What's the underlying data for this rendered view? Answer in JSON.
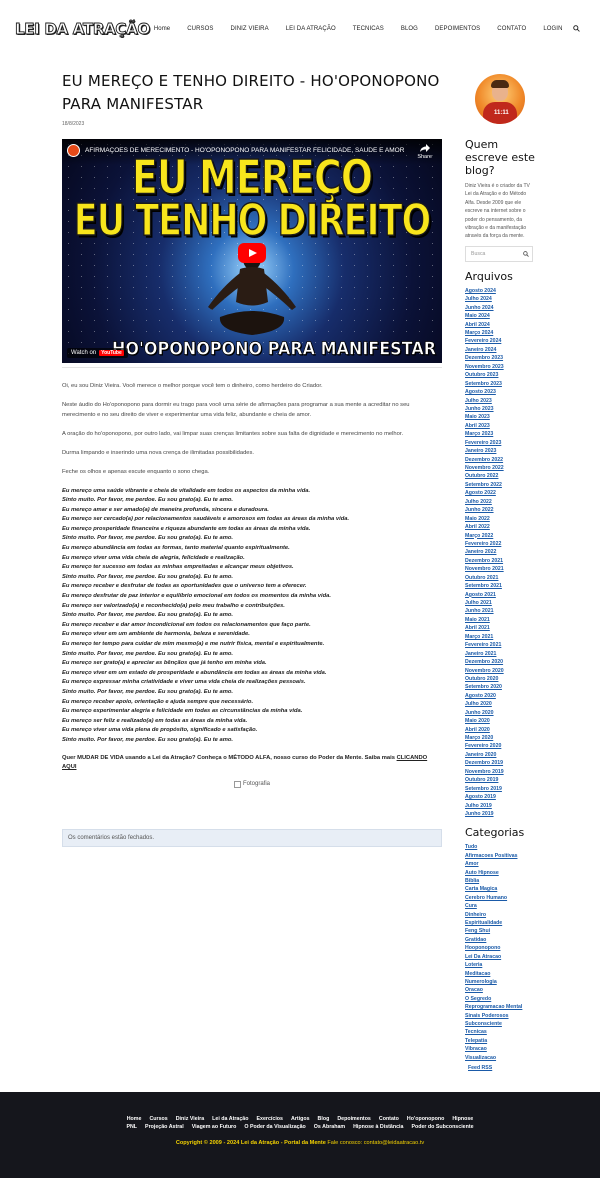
{
  "header": {
    "logo": "LEI DA ATRAÇÃO",
    "nav": [
      "Home",
      "CURSOS",
      "DINIZ VIEIRA",
      "LEI DA ATRAÇÃO",
      "TECNICAS",
      "BLOG",
      "DEPOIMENTOS",
      "CONTATO",
      "LOGIN"
    ]
  },
  "post": {
    "title": "EU MEREÇO E TENHO DIREITO - HO'OPONOPONO PARA MANIFESTAR",
    "date": "18/8/2023",
    "video": {
      "title": "AFIRMAÇÕES DE MERECIMENTO - HO'OPONOPONO PARA MANIFESTAR FELICIDADE, SAÚDE E AMOR | O...",
      "share": "Share",
      "line1": "EU MEREÇO",
      "line2": "EU TENHO DIREITO",
      "line3": "HO'OPONOPONO PARA MANIFESTAR",
      "watch_on": "Watch on",
      "yt": "YouTube"
    },
    "paragraphs": [
      "Oi, eu sou Diniz Vieira. Você merece o melhor porque você tem o dinheiro, como herdeiro do Criador.",
      "Neste áudio do Ho'oponopono para dormir eu trago para você uma série de afirmações para programar a sua mente a acreditar no seu merecimento e no seu direito de viver e experimentar uma vida feliz, abundante e cheia de amor.",
      "A oração do ho'oponopono, por outro lado, vai limpar suas crenças limitantes sobre sua falta de dignidade e merecimento no melhor.",
      "Durma limpando e inserindo uma nova crença de ilimitadas possibilidades.",
      "Feche os olhos e apenas escute enquanto o sono chega."
    ],
    "affirmations": [
      "Eu mereço uma saúde vibrante e cheia de vitalidade em todos os aspectos da minha vida.",
      "Sinto muito. Por favor, me perdoe. Eu sou grato(a). Eu te amo.",
      "Eu mereço amar e ser amado(a) de maneira profunda, sincera e duradoura.",
      "Eu mereço ser cercado(a) por relacionamentos saudáveis e amorosos em todas as áreas da minha vida.",
      "Eu mereço prosperidade financeira e riqueza abundante em todas as áreas da minha vida.",
      "Sinto muito. Por favor, me perdoe. Eu sou grato(a). Eu te amo.",
      "Eu mereço abundância em todas as formas, tanto material quanto espiritualmente.",
      "Eu mereço viver uma vida cheia de alegria, felicidade e realização.",
      "Eu mereço ter sucesso em todas as minhas empreitadas e alcançar meus objetivos.",
      "Sinto muito. Por favor, me perdoe. Eu sou grato(a). Eu te amo.",
      "Eu mereço receber e desfrutar de todas as oportunidades que o universo tem a oferecer.",
      "Eu mereço desfrutar de paz interior e equilíbrio emocional em todos os momentos da minha vida.",
      "Eu mereço ser valorizado(a) e reconhecido(a) pelo meu trabalho e contribuições.",
      "Sinto muito. Por favor, me perdoe. Eu sou grato(a). Eu te amo.",
      "Eu mereço receber e dar amor incondicional em todos os relacionamentos que faço parte.",
      "Eu mereço viver em um ambiente de harmonia, beleza e serenidade.",
      "Eu mereço ter tempo para cuidar de mim mesmo(a) e me nutrir física, mental e espiritualmente.",
      "Sinto muito. Por favor, me perdoe. Eu sou grato(a). Eu te amo.",
      "Eu mereço ser grato(a) e apreciar as bênçãos que já tenho em minha vida.",
      "Eu mereço viver em um estado de prosperidade e abundância em todas as áreas da minha vida.",
      "Eu mereço expressar minha criatividade e viver uma vida cheia de realizações pessoais.",
      "Sinto muito. Por favor, me perdoe. Eu sou grato(a). Eu te amo.",
      "Eu mereço receber apoio, orientação e ajuda sempre que necessário.",
      "Eu mereço experimentar alegria e felicidade em todas as circunstâncias da minha vida.",
      "Eu mereço ser feliz e realizado(a) em todas as áreas da minha vida.",
      "Eu mereço viver uma vida plena de propósito, significado e satisfação.",
      "Sinto muito. Por favor, me perdoe. Eu sou grato(a). Eu te amo."
    ],
    "cta_text": "Quer MUDAR DE VIDA usando a Lei da Atração? Conheça o MÉTODO ALFA, nosso curso do Poder da Mente. Saiba mais ",
    "cta_link": "CLICANDO AQUI",
    "image_alt": "Fotografia",
    "comments_closed": "Os comentários estão fechados."
  },
  "sidebar": {
    "who_title": "Quem escreve este blog?",
    "who_text": "Diniz Vieira é o criador da TV Lei da Atração e do Método Alfa. Desde 2009 que ele escreve na internet sobre o poder do pensamento, da vibração e da manifestação através da força da mente.",
    "search_placeholder": "Busca",
    "archives_title": "Arquivos",
    "archives": [
      "Agosto 2024",
      "Julho 2024",
      "Junho 2024",
      "Maio 2024",
      "Abril 2024",
      "Março 2024",
      "Fevereiro 2024",
      "Janeiro 2024",
      "Dezembro 2023",
      "Novembro 2023",
      "Outubro 2023",
      "Setembro 2023",
      "Agosto 2023",
      "Julho 2023",
      "Junho 2023",
      "Maio 2023",
      "Abril 2023",
      "Março 2023",
      "Fevereiro 2023",
      "Janeiro 2023",
      "Dezembro 2022",
      "Novembro 2022",
      "Outubro 2022",
      "Setembro 2022",
      "Agosto 2022",
      "Julho 2022",
      "Junho 2022",
      "Maio 2022",
      "Abril 2022",
      "Março 2022",
      "Fevereiro 2022",
      "Janeiro 2022",
      "Dezembro 2021",
      "Novembro 2021",
      "Outubro 2021",
      "Setembro 2021",
      "Agosto 2021",
      "Julho 2021",
      "Junho 2021",
      "Maio 2021",
      "Abril 2021",
      "Março 2021",
      "Fevereiro 2021",
      "Janeiro 2021",
      "Dezembro 2020",
      "Novembro 2020",
      "Outubro 2020",
      "Setembro 2020",
      "Agosto 2020",
      "Julho 2020",
      "Junho 2020",
      "Maio 2020",
      "Abril 2020",
      "Março 2020",
      "Fevereiro 2020",
      "Janeiro 2020",
      "Dezembro 2019",
      "Novembro 2019",
      "Outubro 2019",
      "Setembro 2019",
      "Agosto 2019",
      "Julho 2019",
      "Junho 2019"
    ],
    "categories_title": "Categorias",
    "categories": [
      "Tudo",
      "Afirmacoes Positivas",
      "Amor",
      "Auto Hipnose",
      "Biblia",
      "Carta Magica",
      "Cerebro Humano",
      "Cura",
      "Dinheiro",
      "Espiritualidade",
      "Feng Shui",
      "Gratidao",
      "Hooponopono",
      "Lei Da Atracao",
      "Loteria",
      "Meditacao",
      "Numerologia",
      "Oracao",
      "O Segredo",
      "Reprogramacao Mental",
      "Sinais Poderosos",
      "Subconsciente",
      "Tecnicas",
      "Telepatia",
      "Vibracao",
      "Visualizacao"
    ],
    "feed": "Feed RSS"
  },
  "footer": {
    "row1": [
      "Home",
      "Cursos",
      "Diniz Vieira",
      "Lei da Atração",
      "Exercícios",
      "Artigos",
      "Blog",
      "Depoimentos",
      "Contato",
      "Ho'oponopono",
      "Hipnose"
    ],
    "row2": [
      "PNL",
      "Projeção Astral",
      "Viagem ao Futuro",
      "O Poder da Visualização",
      "Os Abraham",
      "Hipnose à Distância",
      "Poder do Subconsciente"
    ],
    "copyright": "Copyright © 2009 - 2024 Lei da Atração - Portal da Mente",
    "contact": " Fale conosco: contato@leidaatracao.tv"
  }
}
